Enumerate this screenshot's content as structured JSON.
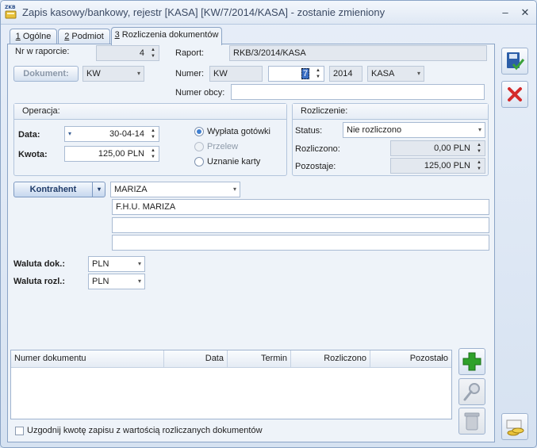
{
  "window": {
    "title": "Zapis kasowy/bankowy, rejestr [KASA] [KW/7/2014/KASA] - zostanie zmieniony",
    "app_icon_label": "ZKB",
    "minimize": "–",
    "close": "✕"
  },
  "tabs": [
    {
      "num": "1",
      "label": " Ogólne"
    },
    {
      "num": "2",
      "label": " Podmiot"
    },
    {
      "num": "3",
      "label": " Rozliczenia dokumentów"
    }
  ],
  "top": {
    "nr_w_raporcie_label": "Nr w raporcie:",
    "nr_w_raporcie_value": "4",
    "dokument_button": "Dokument:",
    "dokument_value": "KW",
    "raport_label": "Raport:",
    "raport_value": "RKB/3/2014/KASA",
    "numer_label": "Numer:",
    "numer_prefix": "KW",
    "numer_value": "7",
    "numer_year": "2014",
    "numer_register": "KASA",
    "numer_obcy_label": "Numer obcy:",
    "numer_obcy_value": ""
  },
  "operacja": {
    "title": "Operacja:",
    "data_label": "Data:",
    "data_value": "30-04-14",
    "kwota_label": "Kwota:",
    "kwota_value": "125,00 PLN",
    "radios": [
      {
        "label": "Wypłata gotówki",
        "selected": true,
        "enabled": true
      },
      {
        "label": "Przelew",
        "selected": false,
        "enabled": false
      },
      {
        "label": "Uznanie karty",
        "selected": false,
        "enabled": true
      }
    ]
  },
  "rozliczenie": {
    "title": "Rozliczenie:",
    "status_label": "Status:",
    "status_value": "Nie rozliczono",
    "rozliczono_label": "Rozliczono:",
    "rozliczono_value": "0,00 PLN",
    "pozostaje_label": "Pozostaje:",
    "pozostaje_value": "125,00 PLN"
  },
  "kontrahent": {
    "button": "Kontrahent",
    "code": "MARIZA",
    "name1": "F.H.U. MARIZA",
    "name2": "",
    "name3": ""
  },
  "waluty": {
    "waluta_dok_label": "Waluta dok.:",
    "waluta_dok_value": "PLN",
    "waluta_rozl_label": "Waluta rozl.:",
    "waluta_rozl_value": "PLN"
  },
  "table": {
    "columns": [
      "Numer dokumentu",
      "Data",
      "Termin",
      "Rozliczono",
      "Pozostało"
    ],
    "rows": []
  },
  "footer": {
    "checkbox_label": "Uzgodnij kwotę zapisu z wartością rozliczanych dokumentów",
    "checked": false
  },
  "colors": {
    "accent": "#3f7fd0",
    "save": "#2c5ea8",
    "cancel": "#d42a2a",
    "add": "#2fa12a"
  }
}
